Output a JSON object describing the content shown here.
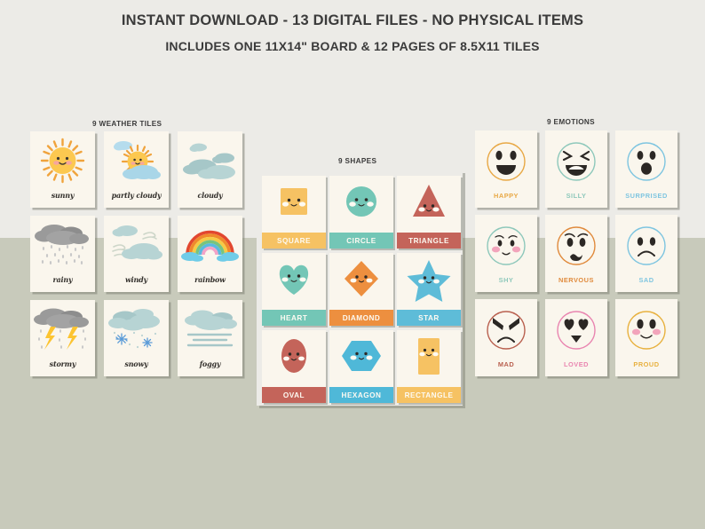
{
  "header": {
    "line1": "INSTANT DOWNLOAD - 13 DIGITAL FILES - NO PHYSICAL ITEMS",
    "line2": "INCLUDES ONE 11X14\" BOARD & 12 PAGES OF 8.5X11 TILES"
  },
  "sections": {
    "weather_title": "9 WEATHER TILES",
    "shapes_title": "9 SHAPES",
    "emotions_title": "9 EMOTIONS"
  },
  "colors": {
    "background_top": "#ecebe7",
    "background_bottom": "#c8cabb",
    "card": "#faf6ed",
    "text_dark": "#3b3b3b"
  },
  "weather": {
    "tiles": [
      {
        "label": "sunny",
        "icon": "sun-icon"
      },
      {
        "label": "partly cloudy",
        "icon": "sun-behind-cloud-icon"
      },
      {
        "label": "cloudy",
        "icon": "cloud-icon"
      },
      {
        "label": "rainy",
        "icon": "rain-cloud-icon"
      },
      {
        "label": "windy",
        "icon": "wind-cloud-icon"
      },
      {
        "label": "rainbow",
        "icon": "rainbow-icon"
      },
      {
        "label": "stormy",
        "icon": "thunderstorm-icon"
      },
      {
        "label": "snowy",
        "icon": "snow-cloud-icon"
      },
      {
        "label": "foggy",
        "icon": "fog-icon"
      }
    ]
  },
  "shapes": {
    "tiles": [
      {
        "label": "SQUARE",
        "icon": "square-shape-icon",
        "color": "#f6c263"
      },
      {
        "label": "CIRCLE",
        "icon": "circle-shape-icon",
        "color": "#73c6b6"
      },
      {
        "label": "TRIANGLE",
        "icon": "triangle-shape-icon",
        "color": "#c4645a"
      },
      {
        "label": "HEART",
        "icon": "heart-shape-icon",
        "color": "#73c6b6"
      },
      {
        "label": "DIAMOND",
        "icon": "diamond-shape-icon",
        "color": "#ed8f3f"
      },
      {
        "label": "STAR",
        "icon": "star-shape-icon",
        "color": "#5ebcd8"
      },
      {
        "label": "OVAL",
        "icon": "oval-shape-icon",
        "color": "#c4645a"
      },
      {
        "label": "HEXAGON",
        "icon": "hexagon-shape-icon",
        "color": "#4fb8d8"
      },
      {
        "label": "RECTANGLE",
        "icon": "rectangle-shape-icon",
        "color": "#f6c263"
      }
    ]
  },
  "emotions": {
    "tiles": [
      {
        "label": "HAPPY",
        "icon": "happy-face-icon",
        "color": "#e8a845"
      },
      {
        "label": "SILLY",
        "icon": "silly-face-icon",
        "color": "#8ec8bb"
      },
      {
        "label": "SURPRISED",
        "icon": "surprised-face-icon",
        "color": "#7ec5e0"
      },
      {
        "label": "SHY",
        "icon": "shy-face-icon",
        "color": "#8ec8bb"
      },
      {
        "label": "NERVOUS",
        "icon": "nervous-face-icon",
        "color": "#e08a3c"
      },
      {
        "label": "SAD",
        "icon": "sad-face-icon",
        "color": "#7ec5e0"
      },
      {
        "label": "MAD",
        "icon": "mad-face-icon",
        "color": "#b9604f"
      },
      {
        "label": "LOVED",
        "icon": "loved-face-icon",
        "color": "#e985b0"
      },
      {
        "label": "PROUD",
        "icon": "proud-face-icon",
        "color": "#e8b13f"
      }
    ]
  }
}
